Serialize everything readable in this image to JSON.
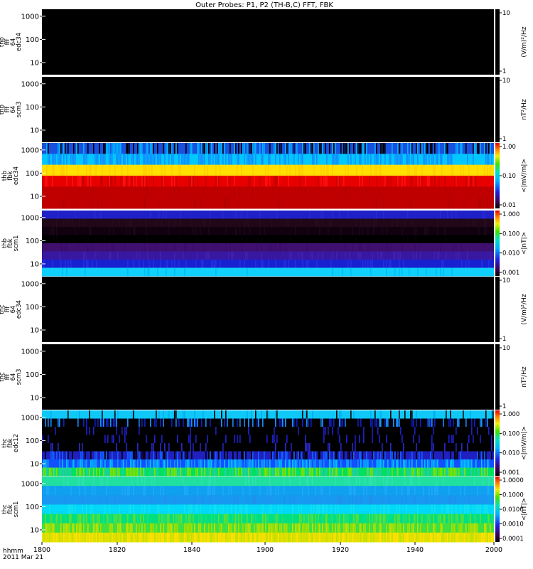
{
  "title": "Outer Probes: P1, P2 (TH-B,C) FFT, FBK",
  "x_axis": {
    "label_line1": "hhmm",
    "label_line2": "2011 Mar 21",
    "range": [
      1800,
      2000
    ],
    "ticks": [
      "1800",
      "1820",
      "1840",
      "1900",
      "1920",
      "1940",
      "2000"
    ]
  },
  "chart_data": [
    {
      "type": "heatmap",
      "panel_label": [
        "thb",
        "fff",
        "64",
        "edc34"
      ],
      "y_scale": "log",
      "y_ticks": [
        "1000",
        "100",
        "10"
      ],
      "colorbar": {
        "label": "(V/m)²/Hz",
        "ticks": [
          "10",
          "1"
        ],
        "visible_gradient": false
      },
      "content": "empty"
    },
    {
      "type": "heatmap",
      "panel_label": [
        "thb",
        "fff",
        "64",
        "scm3"
      ],
      "y_scale": "log",
      "y_ticks": [
        "1000",
        "100",
        "10"
      ],
      "colorbar": {
        "label": "nT²/Hz",
        "ticks": [
          "10",
          "1"
        ],
        "visible_gradient": false
      },
      "content": "empty"
    },
    {
      "type": "heatmap",
      "panel_label": [
        "thb",
        "fbk",
        "edc34"
      ],
      "y_scale": "log",
      "y_ticks": [
        "1000",
        "100",
        "10"
      ],
      "colorbar": {
        "label": "<|mV/m|>",
        "ticks": [
          "1.00",
          "0.10",
          "0.01"
        ],
        "visible_gradient": true
      },
      "bands": [
        {
          "colors": [
            "#1a50e0",
            "#00b0ff",
            "#000000"
          ],
          "density": 0.55
        },
        {
          "colors": [
            "#00c8ff",
            "#1090ff"
          ],
          "density": 0.5
        },
        {
          "colors": [
            "#ffe000",
            "#ffd000"
          ],
          "density": 0.25
        },
        {
          "colors": [
            "#e80000",
            "#c80000",
            "#ff1010"
          ],
          "density": 0.3
        },
        {
          "colors": [
            "#c00000",
            "#b80000"
          ],
          "density": 0.1
        },
        {
          "colors": [
            "#c00000",
            "#b00000"
          ],
          "density": 0.05
        }
      ]
    },
    {
      "type": "heatmap",
      "panel_label": [
        "thb",
        "fbk",
        "scm1"
      ],
      "y_scale": "log",
      "y_ticks": [
        "1000",
        "100",
        "10"
      ],
      "colorbar": {
        "label": "<|nT|>",
        "ticks": [
          "1.000",
          "0.100",
          "0.010",
          "0.001"
        ],
        "visible_gradient": true
      },
      "bands": [
        {
          "colors": [
            "#2020c8",
            "#2828d0"
          ],
          "density": 0.1
        },
        {
          "colors": [
            "#200818",
            "#280a20"
          ],
          "density": 0.2
        },
        {
          "colors": [
            "#100010",
            "#180818"
          ],
          "density": 0.2
        },
        {
          "colors": [
            "#000000",
            "#080008"
          ],
          "density": 0.1
        },
        {
          "colors": [
            "#401070",
            "#3c0c68"
          ],
          "density": 0.15
        },
        {
          "colors": [
            "#3818a0",
            "#4020b0"
          ],
          "density": 0.2
        },
        {
          "colors": [
            "#1820d0",
            "#2030e0"
          ],
          "density": 0.2
        },
        {
          "colors": [
            "#10d0ff",
            "#00c0f0"
          ],
          "density": 0.1
        }
      ]
    },
    {
      "type": "heatmap",
      "panel_label": [
        "thc",
        "fff",
        "64",
        "edc34"
      ],
      "y_scale": "log",
      "y_ticks": [
        "1000",
        "100",
        "10"
      ],
      "colorbar": {
        "label": "(V/m)²/Hz",
        "ticks": [
          "10",
          "1"
        ],
        "visible_gradient": false
      },
      "content": "empty"
    },
    {
      "type": "heatmap",
      "panel_label": [
        "thc",
        "fff",
        "64",
        "scm3"
      ],
      "y_scale": "log",
      "y_ticks": [
        "1000",
        "100",
        "10"
      ],
      "colorbar": {
        "label": "nT²/Hz",
        "ticks": [
          "10",
          "1"
        ],
        "visible_gradient": false
      },
      "content": "empty"
    },
    {
      "type": "heatmap",
      "panel_label": [
        "thc",
        "fbk",
        "edc12"
      ],
      "y_scale": "log",
      "y_ticks": [
        "1000",
        "100",
        "10"
      ],
      "colorbar": {
        "label": "<|mV/m|>",
        "ticks": [
          "1.000",
          "0.100",
          "0.010",
          "0.001"
        ],
        "visible_gradient": true
      },
      "bands": [
        {
          "colors": [
            "#10c8f8",
            "#00b0f0",
            "#000000"
          ],
          "density": 0.2
        },
        {
          "colors": [
            "#000000",
            "#1020c0",
            "#1890ff"
          ],
          "density": 0.35
        },
        {
          "colors": [
            "#000000",
            "#2020c0"
          ],
          "density": 0.08
        },
        {
          "colors": [
            "#000000",
            "#2020d0"
          ],
          "density": 0.12
        },
        {
          "colors": [
            "#000000",
            "#2828c8"
          ],
          "density": 0.15
        },
        {
          "colors": [
            "#2020c0",
            "#000000",
            "#1060ff"
          ],
          "density": 0.5
        },
        {
          "colors": [
            "#1050ff",
            "#1090ff",
            "#00c0ff"
          ],
          "density": 0.6
        },
        {
          "colors": [
            "#00e060",
            "#80e000",
            "#20d0a0"
          ],
          "density": 0.7
        }
      ]
    },
    {
      "type": "heatmap",
      "panel_label": [
        "thc",
        "fbk",
        "scm1"
      ],
      "y_scale": "log",
      "y_ticks": [
        "1000",
        "100",
        "10"
      ],
      "colorbar": {
        "label": "<|nT|>",
        "ticks": [
          "1.0000",
          "0.1000",
          "0.0100",
          "0.0010",
          "0.0001"
        ],
        "visible_gradient": true
      },
      "bands": [
        {
          "colors": [
            "#20e0a0",
            "#30e0b0"
          ],
          "density": 0.2
        },
        {
          "colors": [
            "#10a0f0",
            "#20a8f8"
          ],
          "density": 0.2
        },
        {
          "colors": [
            "#1898f0",
            "#10a0f0",
            "#2090e8"
          ],
          "density": 0.25
        },
        {
          "colors": [
            "#00d8f8",
            "#10e0f0"
          ],
          "density": 0.3
        },
        {
          "colors": [
            "#00e080",
            "#20e070",
            "#60e030"
          ],
          "density": 0.5
        },
        {
          "colors": [
            "#40e040",
            "#a0e000",
            "#c0e000"
          ],
          "density": 0.6
        },
        {
          "colors": [
            "#e0e000",
            "#c0e000",
            "#ffe000"
          ],
          "density": 0.6
        }
      ]
    }
  ]
}
